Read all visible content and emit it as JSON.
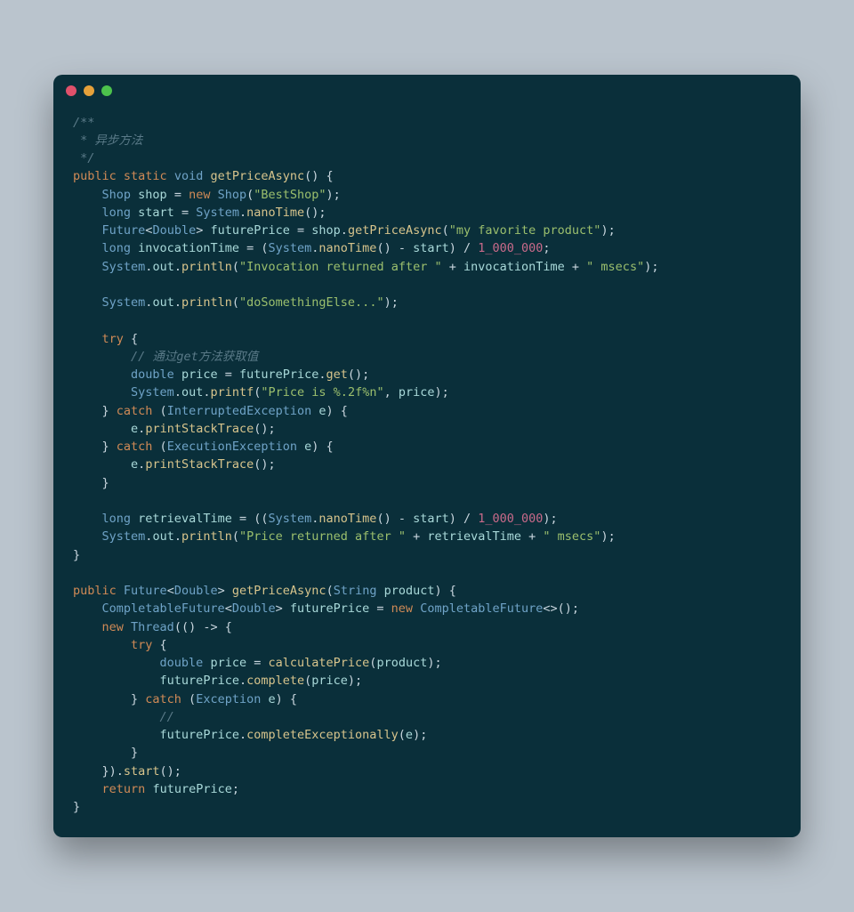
{
  "window": {
    "dots": [
      "red",
      "yellow",
      "green"
    ]
  },
  "code": {
    "comment_block_l1": "/**",
    "comment_block_l2": " * 异步方法",
    "comment_block_l3": " */",
    "l_public": "public",
    "l_static": "static",
    "l_void": "void",
    "l_getPriceAsync": "getPriceAsync",
    "l_Shop": "Shop",
    "l_shop": "shop",
    "l_new": "new",
    "s_BestShop": "\"BestShop\"",
    "l_long": "long",
    "l_start": "start",
    "l_System": "System",
    "l_nanoTime": "nanoTime",
    "l_Future": "Future",
    "l_Double": "Double",
    "l_futurePrice": "futurePrice",
    "s_myfav": "\"my favorite product\"",
    "l_invocationTime": "invocationTime",
    "n_1mil": "1_000_000",
    "l_out": "out",
    "l_println": "println",
    "s_invret": "\"Invocation returned after \"",
    "s_msecs": "\" msecs\"",
    "s_doSomething": "\"doSomethingElse...\"",
    "l_try": "try",
    "c_getcomment": "// 通过get方法获取值",
    "l_double": "double",
    "l_price": "price",
    "l_get": "get",
    "l_printf": "printf",
    "s_priceis": "\"Price is %.2f%n\"",
    "l_catch": "catch",
    "l_InterruptedException": "InterruptedException",
    "l_e": "e",
    "l_printStackTrace": "printStackTrace",
    "l_ExecutionException": "ExecutionException",
    "l_retrievalTime": "retrievalTime",
    "s_priceret": "\"Price returned after \"",
    "l_String": "String",
    "l_product": "product",
    "l_CompletableFuture": "CompletableFuture",
    "l_Thread": "Thread",
    "l_calculatePrice": "calculatePrice",
    "l_complete": "complete",
    "l_Exception": "Exception",
    "c_slashslash": "//",
    "l_completeExceptionally": "completeExceptionally",
    "l_startm": "start",
    "l_return": "return"
  }
}
